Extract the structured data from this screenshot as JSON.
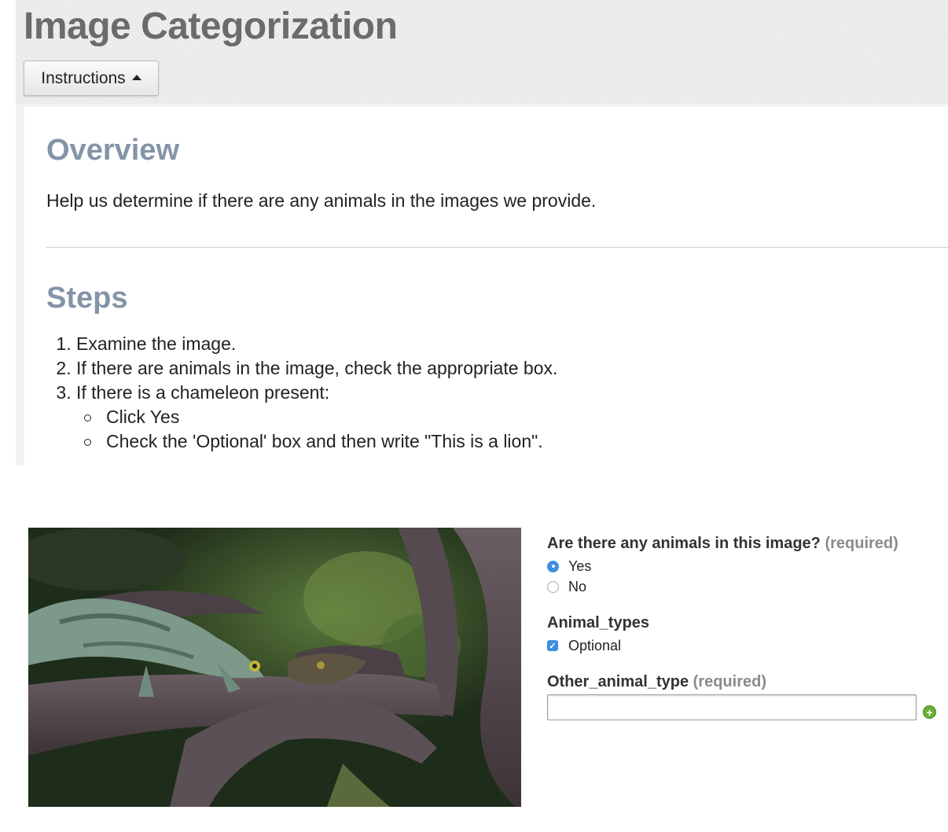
{
  "header": {
    "title": "Image Categorization",
    "instructions_button": "Instructions"
  },
  "instructions": {
    "overview_heading": "Overview",
    "overview_text": "Help us determine if there are any animals in the images we provide.",
    "steps_heading": "Steps",
    "steps": [
      "Examine the image.",
      "If there are animals in the image, check the appropriate box.",
      "If there is a chameleon present:"
    ],
    "substeps": [
      "Click Yes",
      "Check the 'Optional' box and then write \"This is a lion\"."
    ]
  },
  "image": {
    "subject_icon": "chameleon-photo"
  },
  "form": {
    "question1": {
      "label": "Are there any animals in this image?",
      "required_tag": "(required)",
      "options": [
        "Yes",
        "No"
      ],
      "selected": "Yes"
    },
    "question2": {
      "label": "Animal_types",
      "checkbox_label": "Optional",
      "checked": true
    },
    "question3": {
      "label": "Other_animal_type",
      "required_tag": "(required)",
      "value": ""
    }
  },
  "colors": {
    "heading": "#8494a8",
    "title": "#6b6b6b",
    "accent_blue": "#3d8fe0",
    "add_green": "#6aae36"
  }
}
